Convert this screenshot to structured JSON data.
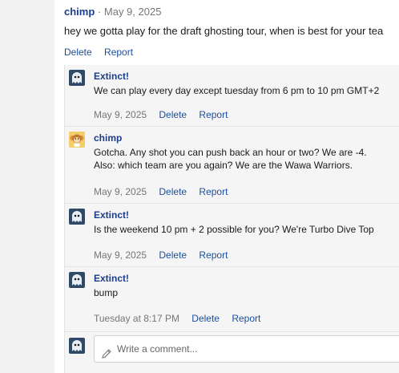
{
  "post": {
    "author": "chimp",
    "separator": "·",
    "date": "May 9, 2025",
    "body": "hey we gotta play for the draft ghosting tour, when is best for your tea",
    "actions": {
      "delete": "Delete",
      "report": "Report"
    }
  },
  "replies": [
    {
      "author": "Extinct!",
      "lines": [
        "We can play every day except tuesday from 6 pm to 10 pm GMT+2"
      ],
      "date": "May 9, 2025",
      "delete": "Delete",
      "report": "Report"
    },
    {
      "author": "chimp",
      "lines": [
        "Gotcha. Any shot you can push back an hour or two? We are -4.",
        "Also: which team are you again? We are the Wawa Warriors."
      ],
      "date": "May 9, 2025",
      "delete": "Delete",
      "report": "Report"
    },
    {
      "author": "Extinct!",
      "lines": [
        "Is the weekend 10 pm + 2 possible for you? We're Turbo Dive Top"
      ],
      "date": "May 9, 2025",
      "delete": "Delete",
      "report": "Report"
    },
    {
      "author": "Extinct!",
      "lines": [
        "bump"
      ],
      "date": "Tuesday at 8:17 PM",
      "delete": "Delete",
      "report": "Report"
    }
  ],
  "comment_box": {
    "placeholder": "Write a comment..."
  },
  "icons": {
    "monkey_avatar": "monkey-avatar-icon",
    "ghost_avatar": "ghost-avatar-icon",
    "pencil": "pencil-icon"
  },
  "colors": {
    "link": "#1b4f9c",
    "author": "#1b3d8a",
    "muted": "#767676",
    "reply_bg": "#f5f5f5"
  }
}
